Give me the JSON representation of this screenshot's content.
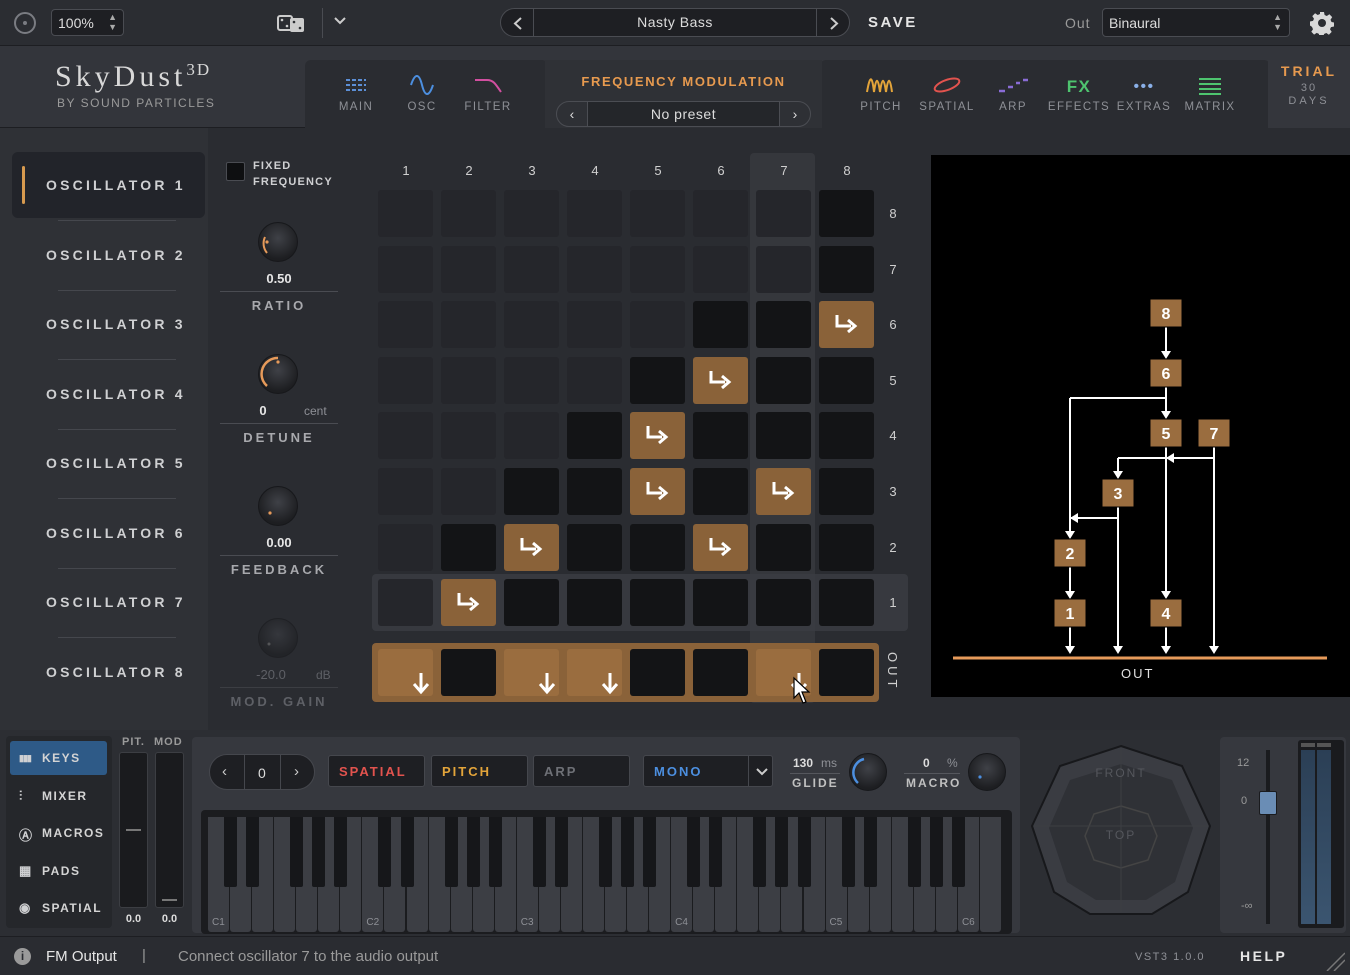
{
  "topbar": {
    "zoom": "100%",
    "preset_name": "Nasty Bass",
    "save_label": "SAVE",
    "out_label": "Out",
    "out_value": "Binaural"
  },
  "header": {
    "logo_title": "SkyDust",
    "logo_sup": "3D",
    "logo_sub": "BY SOUND PARTICLES",
    "tabs_left": [
      {
        "label": "MAIN",
        "icon": "grid-icon",
        "color": "#5c8fd6"
      },
      {
        "label": "OSC",
        "icon": "sine-wave-icon",
        "color": "#4c8fe0"
      },
      {
        "label": "FILTER",
        "icon": "filter-curve-icon",
        "color": "#d24fa0"
      }
    ],
    "fm_title": "FREQUENCY MODULATION",
    "fm_preset": "No preset",
    "tabs_right": [
      {
        "label": "PITCH",
        "icon": "pitch-wave-icon",
        "color": "#e3a43a"
      },
      {
        "label": "SPATIAL",
        "icon": "spatial-orbit-icon",
        "color": "#e2534e"
      },
      {
        "label": "ARP",
        "icon": "arp-icon",
        "color": "#8a6cd6"
      },
      {
        "label": "EFFECTS",
        "icon": "fx-icon",
        "color": "#4ec46f",
        "text": "FX"
      },
      {
        "label": "EXTRAS",
        "icon": "dots-icon",
        "color": "#8ab0e8",
        "text": "•••"
      },
      {
        "label": "MATRIX",
        "icon": "matrix-lines-icon",
        "color": "#4ec46f"
      }
    ],
    "trial_label": "TRIAL",
    "trial_days": "30",
    "trial_unit": "DAYS"
  },
  "oscillators": [
    "OSCILLATOR 1",
    "OSCILLATOR 2",
    "OSCILLATOR 3",
    "OSCILLATOR 4",
    "OSCILLATOR 5",
    "OSCILLATOR 6",
    "OSCILLATOR 7",
    "OSCILLATOR 8"
  ],
  "selected_oscillator": 1,
  "params": {
    "fixed_frequency_label": "FIXED FREQUENCY",
    "ratio_value": "0.50",
    "ratio_label": "RATIO",
    "detune_value": "0",
    "detune_unit": "cent",
    "detune_label": "DETUNE",
    "feedback_value": "0.00",
    "feedback_label": "FEEDBACK",
    "modgain_value": "-20.0",
    "modgain_unit": "dB",
    "modgain_label": "MOD. GAIN"
  },
  "matrix": {
    "columns": [
      "1",
      "2",
      "3",
      "4",
      "5",
      "6",
      "7",
      "8"
    ],
    "rows": [
      "8",
      "7",
      "6",
      "5",
      "4",
      "3",
      "2",
      "1"
    ],
    "out_label": "OUT",
    "connections": [
      {
        "source": 8,
        "target": 6
      },
      {
        "source": 6,
        "target": 5
      },
      {
        "source": 5,
        "target": 4
      },
      {
        "source": 5,
        "target": 3
      },
      {
        "source": 7,
        "target": 3
      },
      {
        "source": 3,
        "target": 2
      },
      {
        "source": 6,
        "target": 2
      },
      {
        "source": 2,
        "target": 1
      }
    ],
    "outputs": [
      1,
      3,
      4,
      7
    ],
    "highlight_column": 7
  },
  "graph": {
    "nodes": [
      "8",
      "6",
      "5",
      "7",
      "3",
      "2",
      "1",
      "4"
    ],
    "out_label": "OUT",
    "accent": "#e69a5a"
  },
  "bottom": {
    "side_items": [
      {
        "label": "KEYS",
        "icon": "piano-keys-icon"
      },
      {
        "label": "MIXER",
        "icon": "mixer-sliders-icon"
      },
      {
        "label": "MACROS",
        "icon": "macro-a-icon"
      },
      {
        "label": "PADS",
        "icon": "pads-grid-icon"
      },
      {
        "label": "SPATIAL",
        "icon": "spatial-dot-icon"
      }
    ],
    "pit_label": "PIT.",
    "mod_label": "MOD",
    "pit_value": "0.0",
    "mod_value": "0.0",
    "octave_value": "0",
    "spatial_btn": "SPATIAL",
    "pitch_btn": "PITCH",
    "arp_btn": "ARP",
    "mono_value": "MONO",
    "glide_value": "130",
    "glide_unit": "ms",
    "glide_label": "GLIDE",
    "macro_value": "0",
    "macro_unit": "%",
    "macro_label": "MACRO",
    "octave_labels": [
      "C1",
      "C2",
      "C3",
      "C4",
      "C5",
      "C6"
    ],
    "front_label": "FRONT",
    "top_label": "TOP",
    "meter_labels": [
      "12",
      "0",
      "-∞"
    ]
  },
  "status": {
    "section": "FM Output",
    "message": "Connect oscillator 7 to the audio output",
    "version": "VST3 1.0.0",
    "help": "HELP"
  }
}
